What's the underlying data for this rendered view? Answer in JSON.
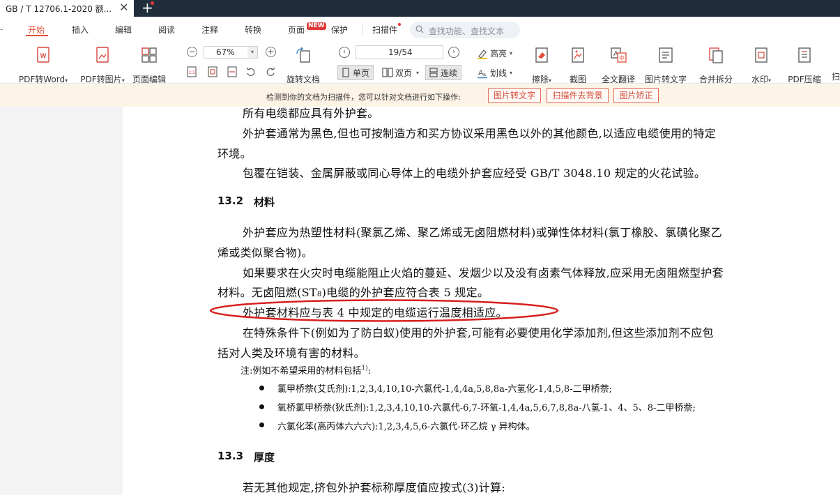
{
  "titlebar": {
    "doc_tab_title": "GB / T 12706.1-2020 额...",
    "close": "✕",
    "new_tab": "+"
  },
  "menu": {
    "items": [
      "开始",
      "插入",
      "编辑",
      "阅读",
      "注释",
      "转换",
      "页面",
      "保护",
      "扫描件"
    ],
    "new_badge": "NEW",
    "search_placeholder": "查找功能、查找文本",
    "left_edge": "-"
  },
  "toolbar": {
    "pdf_to_word": "PDF转Word",
    "pdf_to_image": "PDF转图片",
    "page_edit": "页面编辑",
    "zoom": "67%",
    "rotate": "旋转文档",
    "page_indicator": "19/54",
    "single": "单页",
    "double": "双页",
    "continuous": "连续",
    "highlight": "高亮",
    "strikeline": "划线",
    "erase": "擦除",
    "screenshot": "截图",
    "full_translate": "全文翻译",
    "img_to_text": "图片转文字",
    "merge_split": "合并拆分",
    "watermark": "水印",
    "compress": "PDF压缩",
    "more": "扫"
  },
  "notify": {
    "message": "检测到你的文档为扫描件，您可以针对文档进行如下操作:",
    "btn1": "图片转文字",
    "btn2": "扫描件去背景",
    "btn3": "图片矫正"
  },
  "doc": {
    "l1": "所有电缆都应具有外护套。",
    "l2": "外护套通常为黑色,但也可按制造方和买方协议采用黑色以外的其他颜色,以适应电缆使用的特定",
    "l3": "环境。",
    "l4": "包覆在铠装、金属屏蔽或同心导体上的电缆外护套应经受 GB/T 3048.10 规定的火花试验。",
    "h132_num": "13.2",
    "h132_title": "材料",
    "l5": "外护套应为热塑性材料(聚氯乙烯、聚乙烯或无卤阻燃材料)或弹性体材料(氯丁橡胶、氯磺化聚乙",
    "l6": "烯或类似聚合物)。",
    "l7": "如果要求在火灾时电缆能阻止火焰的蔓延、发烟少以及没有卤素气体释放,应采用无卤阻燃型护套",
    "l8a": "材料。无卤阻燃(ST",
    "l8sub": "8",
    "l8b": ")电缆的外护套应符合表 5 规定。",
    "l9": "外护套材料应与表 4 中规定的电缆运行温度相适应。",
    "l10": "在特殊条件下(例如为了防白蚁)使用的外护套,可能有必要使用化学添加剂,但这些添加剂不应包",
    "l11": "括对人类及环境有害的材料。",
    "note_a": "注:例如不希望采用的材料包括",
    "note_sup": "1)",
    "note_b": ":",
    "b1": "氯甲桥萘(艾氏剂):1,2,3,4,10,10-六氯代-1,4,4a,5,8,8a-六氢化-1,4,5,8-二甲桥萘;",
    "b2": "氧桥氯甲桥萘(狄氏剂):1,2,3,4,10,10-六氯代-6,7-环氧-1,4,4a,5,6,7,8,8a-八氢-1、4、5、8-二甲桥萘;",
    "b3": "六氯化苯(高丙体六六六):1,2,3,4,5,6-六氯代-环乙烷 γ 异构体。",
    "h133_num": "13.3",
    "h133_title": "厚度",
    "l12": "若无其他规定,挤包外护套标称厚度值应按式(3)计算:"
  }
}
